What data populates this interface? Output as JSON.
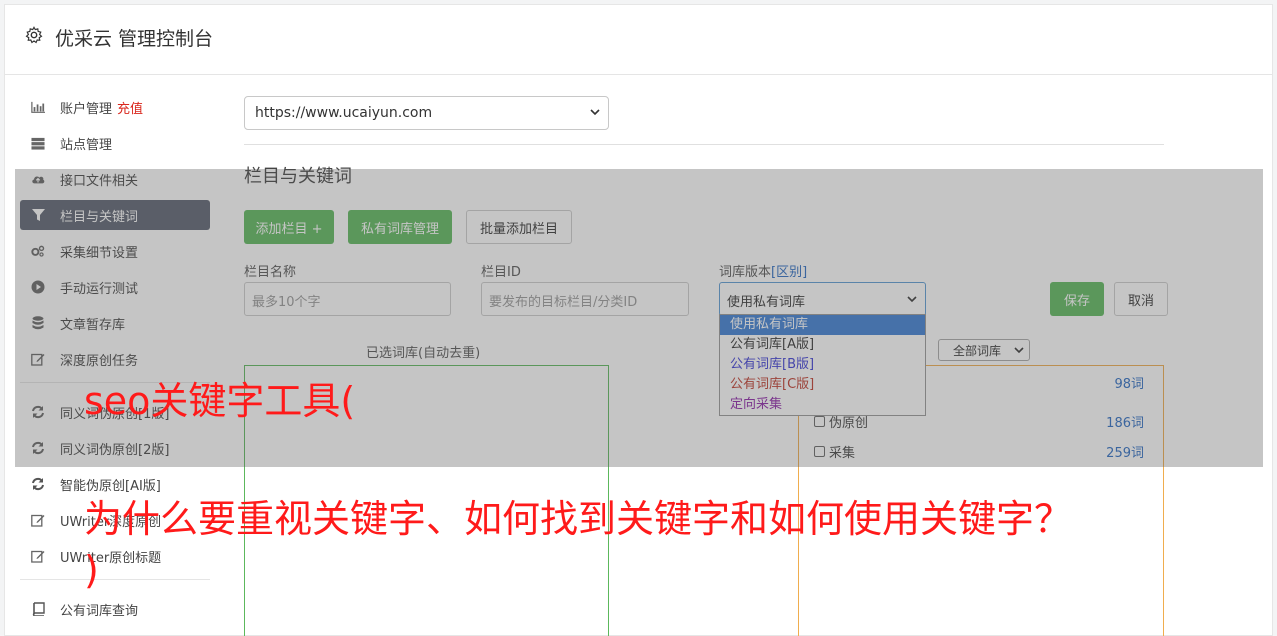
{
  "header": {
    "title": "优采云 管理控制台"
  },
  "sidebar": {
    "items": [
      {
        "label": "账户管理",
        "extra": "充值",
        "icon": "bar-chart-icon"
      },
      {
        "label": "站点管理",
        "icon": "server-icon"
      },
      {
        "label": "接口文件相关",
        "icon": "cloud-upload-icon"
      },
      {
        "label": "栏目与关键词",
        "icon": "filter-icon",
        "active": true
      },
      {
        "label": "采集细节设置",
        "icon": "gears-icon"
      },
      {
        "label": "手动运行测试",
        "icon": "play-icon"
      },
      {
        "label": "文章暂存库",
        "icon": "database-icon"
      },
      {
        "label": "深度原创任务",
        "icon": "edit-icon"
      }
    ],
    "items2": [
      {
        "label": "同义词伪原创[1版]",
        "icon": "refresh-icon"
      },
      {
        "label": "同义词伪原创[2版]",
        "icon": "refresh-icon"
      },
      {
        "label": "智能伪原创[AI版]",
        "icon": "refresh-icon"
      },
      {
        "label": "UWriter深度原创",
        "icon": "edit-icon"
      },
      {
        "label": "UWriter原创标题",
        "icon": "edit-icon"
      }
    ],
    "items3": [
      {
        "label": "公有词库查询",
        "icon": "book-icon"
      }
    ]
  },
  "main": {
    "site_select": "https://www.ucaiyun.com",
    "section_title": "栏目与关键词",
    "buttons": {
      "add_column": "添加栏目 +",
      "private_lib": "私有词库管理",
      "batch_add": "批量添加栏目"
    },
    "form": {
      "name_label": "栏目名称",
      "name_placeholder": "最多10个字",
      "id_label": "栏目ID",
      "id_placeholder": "要发布的目标栏目/分类ID",
      "version_label": "词库版本",
      "version_link": "[区别]",
      "version_value": "使用私有词库",
      "save": "保存",
      "cancel": "取消"
    },
    "dropdown_options": [
      {
        "label": "使用私有词库",
        "color": "#ffffff",
        "selected": true
      },
      {
        "label": "公有词库[A版]",
        "color": "#333333"
      },
      {
        "label": "公有词库[B版]",
        "color": "#3b3bd6"
      },
      {
        "label": "公有词库[C版]",
        "color": "#c0392b"
      },
      {
        "label": "定向采集",
        "color": "#8e24aa"
      }
    ],
    "selected_caption": "已选词库(自动去重)",
    "lib_filter": "全部词库",
    "lib_rows": [
      {
        "label": "",
        "count": "98词"
      },
      {
        "label": "伪原创",
        "count": "186词"
      },
      {
        "label": "采集",
        "count": "259词"
      }
    ]
  },
  "captions": {
    "line1": "seo关键字工具(",
    "line2": "为什么要重视关键字、如何找到关键字和如何使用关键字？",
    "line3": ")"
  }
}
